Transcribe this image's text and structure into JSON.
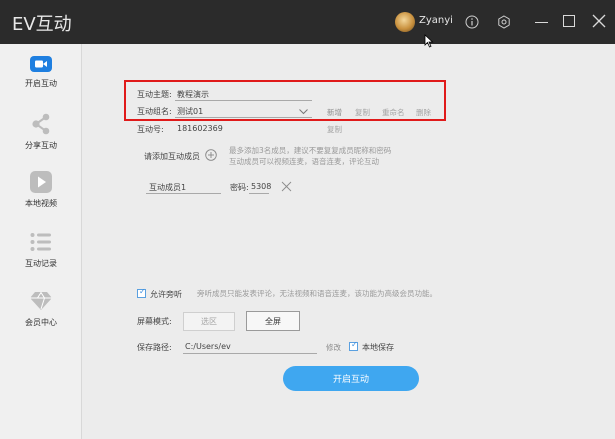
{
  "titlebar": {
    "app_title": "EV互动",
    "username": "Zyanyi",
    "icons": [
      "info-icon",
      "gear-icon",
      "minimize-icon",
      "maximize-icon",
      "close-icon"
    ]
  },
  "sidebar": {
    "items": [
      {
        "label": "开启互动",
        "icon": "video-camera-icon",
        "active": true
      },
      {
        "label": "分享互动",
        "icon": "share-icon",
        "active": false
      },
      {
        "label": "本地视频",
        "icon": "play-icon",
        "active": false
      },
      {
        "label": "互动记录",
        "icon": "list-icon",
        "active": false
      },
      {
        "label": "会员中心",
        "icon": "diamond-icon",
        "active": false
      }
    ]
  },
  "form": {
    "topic_label": "互动主题:",
    "topic_value": "教程演示",
    "group_label": "互动组名:",
    "group_value": "测试01",
    "group_actions": [
      "新增",
      "复制",
      "重命名",
      "删除"
    ],
    "id_label": "互动号:",
    "id_value": "181602369",
    "id_copy": "复制",
    "add_member_label": "请添加互动成员",
    "add_member_hint_1": "最多添加3名成员，建议不要复复成员昵称和密码",
    "add_member_hint_2": "互动成员可以视频连麦，语音连麦，评论互动",
    "member_name": "互动成员1",
    "password_label": "密码:",
    "password_value": "5308",
    "allow_bystander_label": "允许旁听",
    "allow_bystander_hint": "旁听成员只能发表评论，无法视频和语音连麦，该功能为高级会员功能。",
    "screen_mode_label": "屏幕模式:",
    "screen_mode_options": [
      "选区",
      "全屏"
    ],
    "save_path_label": "保存路径:",
    "save_path_value": "C:/Users/ev",
    "modify_label": "修改",
    "local_save_label": "本地保存",
    "start_button": "开启互动"
  },
  "colors": {
    "titlebar_bg": "#2b2b2b",
    "accent": "#3fa7f0",
    "highlight_box": "#e01a1a",
    "sidebar_active_icon": "#1f7fe0",
    "sidebar_icon": "#bdbdbd"
  }
}
